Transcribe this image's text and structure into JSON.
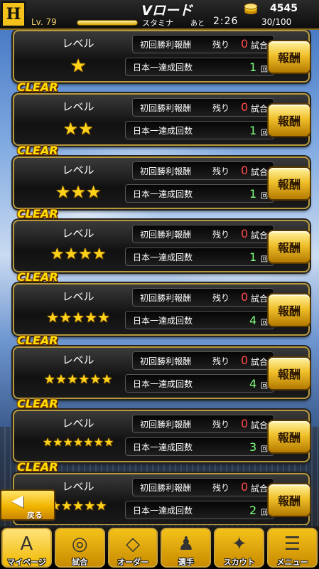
{
  "header": {
    "logo_text": "H",
    "level": "Lv. 79",
    "title": "Vロード",
    "stamina_label": "スタミナ",
    "ato_label": "あと",
    "timer": "2:26",
    "stamina_value": "30/100",
    "coins": "4545",
    "coin_icon": "coin-stack-icon"
  },
  "items": [
    {
      "clear": "",
      "level_label": "レベル",
      "stars": "★",
      "first_reward_label": "初回勝利報酬",
      "remain_label": "残り",
      "remain_count": "0",
      "remain_unit": "試合",
      "champion_label": "日本一達成回数",
      "champion_count": "1",
      "champion_unit": "回",
      "reward_button": "報酬"
    },
    {
      "clear": "CLEAR",
      "level_label": "レベル",
      "stars": "★★",
      "first_reward_label": "初回勝利報酬",
      "remain_label": "残り",
      "remain_count": "0",
      "remain_unit": "試合",
      "champion_label": "日本一達成回数",
      "champion_count": "1",
      "champion_unit": "回",
      "reward_button": "報酬"
    },
    {
      "clear": "CLEAR",
      "level_label": "レベル",
      "stars": "★★★",
      "first_reward_label": "初回勝利報酬",
      "remain_label": "残り",
      "remain_count": "0",
      "remain_unit": "試合",
      "champion_label": "日本一達成回数",
      "champion_count": "1",
      "champion_unit": "回",
      "reward_button": "報酬"
    },
    {
      "clear": "CLEAR",
      "level_label": "レベル",
      "stars": "★★★★",
      "first_reward_label": "初回勝利報酬",
      "remain_label": "残り",
      "remain_count": "0",
      "remain_unit": "試合",
      "champion_label": "日本一達成回数",
      "champion_count": "1",
      "champion_unit": "回",
      "reward_button": "報酬"
    },
    {
      "clear": "CLEAR",
      "level_label": "レベル",
      "stars": "★★★★★",
      "first_reward_label": "初回勝利報酬",
      "remain_label": "残り",
      "remain_count": "0",
      "remain_unit": "試合",
      "champion_label": "日本一達成回数",
      "champion_count": "4",
      "champion_unit": "回",
      "reward_button": "報酬"
    },
    {
      "clear": "CLEAR",
      "level_label": "レベル",
      "stars": "★★★★★★",
      "first_reward_label": "初回勝利報酬",
      "remain_label": "残り",
      "remain_count": "0",
      "remain_unit": "試合",
      "champion_label": "日本一達成回数",
      "champion_count": "4",
      "champion_unit": "回",
      "reward_button": "報酬"
    },
    {
      "clear": "CLEAR",
      "level_label": "レベル",
      "stars": "★★★★★★★",
      "first_reward_label": "初回勝利報酬",
      "remain_label": "残り",
      "remain_count": "0",
      "remain_unit": "試合",
      "champion_label": "日本一達成回数",
      "champion_count": "3",
      "champion_unit": "回",
      "reward_button": "報酬"
    },
    {
      "clear": "CLEAR",
      "level_label": "レベル",
      "stars": "★★★★★",
      "first_reward_label": "初回勝利報酬",
      "remain_label": "残り",
      "remain_count": "0",
      "remain_unit": "試合",
      "champion_label": "日本一達成回数",
      "champion_count": "2",
      "champion_unit": "回",
      "reward_button": "報酬"
    }
  ],
  "back_button": {
    "label": "戻る",
    "icon": "back-arrow-icon"
  },
  "nav": [
    {
      "label": "マイページ",
      "icon": "letter-a-icon",
      "glyph": "A"
    },
    {
      "label": "試合",
      "icon": "stadium-icon",
      "glyph": "◎"
    },
    {
      "label": "オーダー",
      "icon": "field-diamond-icon",
      "glyph": "◇"
    },
    {
      "label": "選手",
      "icon": "player-icon",
      "glyph": "♟"
    },
    {
      "label": "スカウト",
      "icon": "scout-card-icon",
      "glyph": "✦"
    },
    {
      "label": "メニュー",
      "icon": "menu-icon",
      "glyph": "☰"
    }
  ],
  "colors": {
    "gold": "#f4c21a",
    "clear_yellow": "#ffe000",
    "remain_red": "#ff4a4a",
    "count_green": "#7dff7d"
  }
}
